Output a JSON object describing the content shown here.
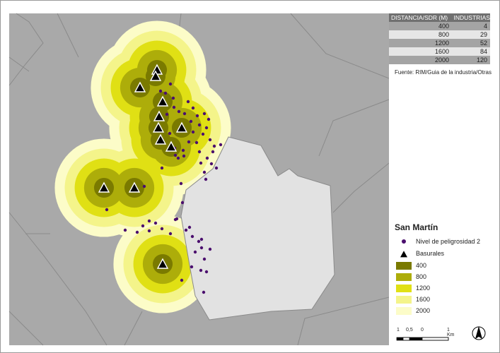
{
  "distance_table": {
    "headers": [
      "DISTANCIA/SDR (M)",
      "INDUSTRIAS"
    ],
    "rows": [
      [
        "400",
        "4"
      ],
      [
        "800",
        "29"
      ],
      [
        "1200",
        "52"
      ],
      [
        "1600",
        "84"
      ],
      [
        "2000",
        "120"
      ]
    ]
  },
  "source_note": "Fuente: RIM/Guia de la industria/Otras",
  "legend": {
    "title": "San Martín",
    "points_label": "Nivel de peligrosidad 2",
    "landfills_label": "Basurales",
    "buffers": [
      {
        "label": "400",
        "color": "#7a7a00"
      },
      {
        "label": "800",
        "color": "#adad0a"
      },
      {
        "label": "1200",
        "color": "#e0e014"
      },
      {
        "label": "1600",
        "color": "#f4f48a"
      },
      {
        "label": "2000",
        "color": "#fcfcc8"
      }
    ]
  },
  "scale_bar": {
    "tick_labels": [
      "1",
      "0,5",
      "0",
      "1 Km"
    ]
  },
  "colors": {
    "background_land": "#a9a9a9",
    "district": "#e2e2e2",
    "industry_point": "#4b0f6e",
    "boundary_line": "#8a8a8a"
  },
  "icons": {
    "north_arrow": "north-arrow-icon",
    "landfill": "triangle-icon",
    "industry": "point-icon"
  }
}
